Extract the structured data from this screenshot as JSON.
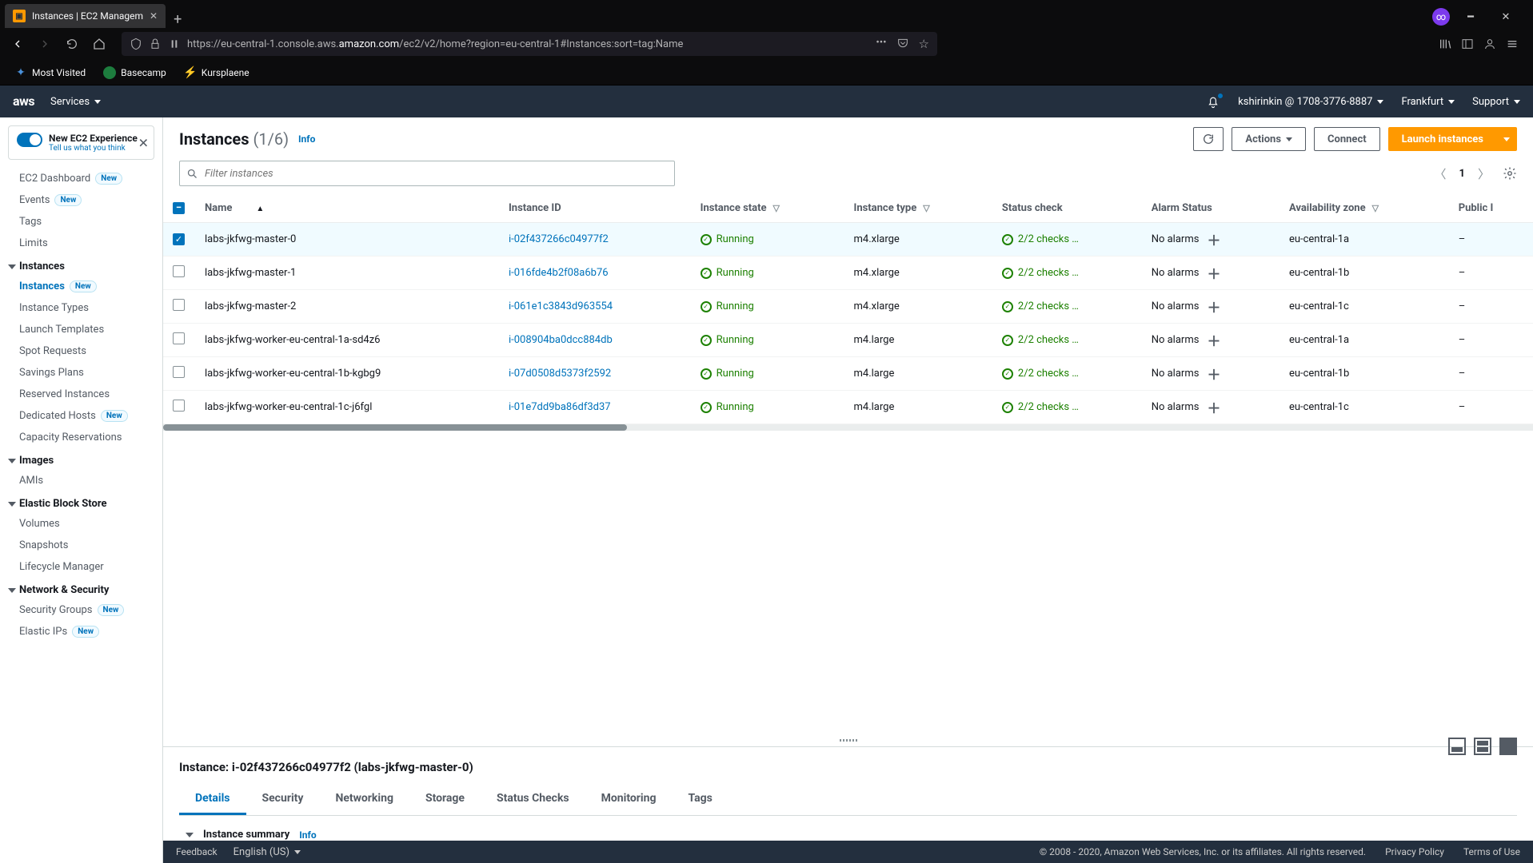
{
  "browser": {
    "tab_title": "Instances | EC2 Managem",
    "url_prefix": "https://eu-central-1.console.aws.",
    "url_highlight": "amazon.com",
    "url_suffix": "/ec2/v2/home?region=eu-central-1#Instances:sort=tag:Name",
    "bookmarks": [
      "Most Visited",
      "Basecamp",
      "Kursplaene"
    ]
  },
  "header": {
    "brand": "aws",
    "services": "Services",
    "account": "kshirinkin @ 1708-3776-8887",
    "region": "Frankfurt",
    "support": "Support"
  },
  "sidebar": {
    "experience_title": "New EC2 Experience",
    "experience_sub": "Tell us what you think",
    "top": [
      {
        "label": "EC2 Dashboard",
        "badge": "New"
      },
      {
        "label": "Events",
        "badge": "New"
      },
      {
        "label": "Tags"
      },
      {
        "label": "Limits"
      }
    ],
    "sections": [
      {
        "title": "Instances",
        "items": [
          {
            "label": "Instances",
            "badge": "New",
            "active": true
          },
          {
            "label": "Instance Types"
          },
          {
            "label": "Launch Templates"
          },
          {
            "label": "Spot Requests"
          },
          {
            "label": "Savings Plans"
          },
          {
            "label": "Reserved Instances"
          },
          {
            "label": "Dedicated Hosts",
            "badge": "New"
          },
          {
            "label": "Capacity Reservations"
          }
        ]
      },
      {
        "title": "Images",
        "items": [
          {
            "label": "AMIs"
          }
        ]
      },
      {
        "title": "Elastic Block Store",
        "items": [
          {
            "label": "Volumes"
          },
          {
            "label": "Snapshots"
          },
          {
            "label": "Lifecycle Manager"
          }
        ]
      },
      {
        "title": "Network & Security",
        "items": [
          {
            "label": "Security Groups",
            "badge": "New"
          },
          {
            "label": "Elastic IPs",
            "badge": "New"
          }
        ]
      }
    ]
  },
  "list": {
    "title": "Instances",
    "count": "(1/6)",
    "info": "Info",
    "refresh_aria": "Refresh",
    "actions": "Actions",
    "connect": "Connect",
    "launch": "Launch instances",
    "filter_placeholder": "Filter instances",
    "page": "1",
    "columns": [
      "",
      "Name",
      "Instance ID",
      "Instance state",
      "Instance type",
      "Status check",
      "Alarm Status",
      "Availability zone",
      "Public I"
    ],
    "status_text": "2/2 checks …",
    "no_alarms": "No alarms",
    "rows": [
      {
        "sel": true,
        "name": "labs-jkfwg-master-0",
        "id": "i-02f437266c04977f2",
        "state": "Running",
        "type": "m4.xlarge",
        "az": "eu-central-1a",
        "pub": "–"
      },
      {
        "sel": false,
        "name": "labs-jkfwg-master-1",
        "id": "i-016fde4b2f08a6b76",
        "state": "Running",
        "type": "m4.xlarge",
        "az": "eu-central-1b",
        "pub": "–"
      },
      {
        "sel": false,
        "name": "labs-jkfwg-master-2",
        "id": "i-061e1c3843d963554",
        "state": "Running",
        "type": "m4.xlarge",
        "az": "eu-central-1c",
        "pub": "–"
      },
      {
        "sel": false,
        "name": "labs-jkfwg-worker-eu-central-1a-sd4z6",
        "id": "i-008904ba0dcc884db",
        "state": "Running",
        "type": "m4.large",
        "az": "eu-central-1a",
        "pub": "–"
      },
      {
        "sel": false,
        "name": "labs-jkfwg-worker-eu-central-1b-kgbg9",
        "id": "i-07d0508d5373f2592",
        "state": "Running",
        "type": "m4.large",
        "az": "eu-central-1b",
        "pub": "–"
      },
      {
        "sel": false,
        "name": "labs-jkfwg-worker-eu-central-1c-j6fgl",
        "id": "i-01e7dd9ba86df3d37",
        "state": "Running",
        "type": "m4.large",
        "az": "eu-central-1c",
        "pub": "–"
      }
    ]
  },
  "details": {
    "title": "Instance: i-02f437266c04977f2 (labs-jkfwg-master-0)",
    "tabs": [
      "Details",
      "Security",
      "Networking",
      "Storage",
      "Status Checks",
      "Monitoring",
      "Tags"
    ],
    "active_tab": 0,
    "summary_heading": "Instance summary",
    "info": "Info"
  },
  "footer": {
    "feedback": "Feedback",
    "language": "English (US)",
    "copyright": "© 2008 - 2020, Amazon Web Services, Inc. or its affiliates. All rights reserved.",
    "privacy": "Privacy Policy",
    "terms": "Terms of Use"
  }
}
